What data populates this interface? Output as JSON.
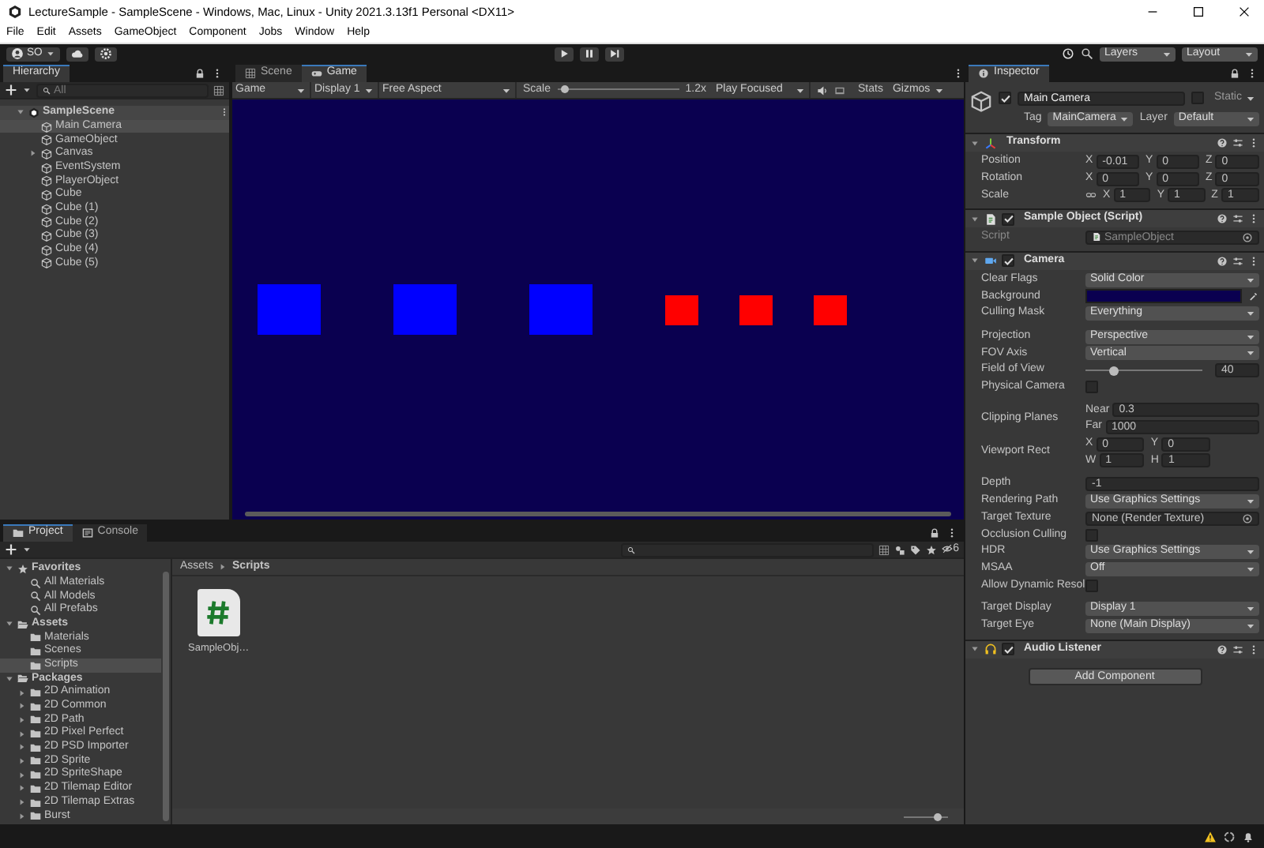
{
  "window": {
    "title": "LectureSample - SampleScene - Windows, Mac, Linux - Unity 2021.3.13f1 Personal <DX11>"
  },
  "menu": [
    "File",
    "Edit",
    "Assets",
    "GameObject",
    "Component",
    "Jobs",
    "Window",
    "Help"
  ],
  "toolbar": {
    "account": "SO",
    "layers": "Layers",
    "layout": "Layout"
  },
  "hierarchy": {
    "title": "Hierarchy",
    "search": {
      "placeholder": "All"
    },
    "scene": "SampleScene",
    "items": [
      {
        "label": "Main Camera",
        "selected": true,
        "has_children": false
      },
      {
        "label": "GameObject",
        "selected": false,
        "has_children": false
      },
      {
        "label": "Canvas",
        "selected": false,
        "has_children": true
      },
      {
        "label": "EventSystem",
        "selected": false,
        "has_children": false
      },
      {
        "label": "PlayerObject",
        "selected": false,
        "has_children": false
      },
      {
        "label": "Cube",
        "selected": false,
        "has_children": false
      },
      {
        "label": "Cube (1)",
        "selected": false,
        "has_children": false
      },
      {
        "label": "Cube (2)",
        "selected": false,
        "has_children": false
      },
      {
        "label": "Cube (3)",
        "selected": false,
        "has_children": false
      },
      {
        "label": "Cube (4)",
        "selected": false,
        "has_children": false
      },
      {
        "label": "Cube (5)",
        "selected": false,
        "has_children": false
      }
    ]
  },
  "game": {
    "tabs": [
      {
        "label": "Scene",
        "kind": "scene",
        "selected": false
      },
      {
        "label": "Game",
        "kind": "game",
        "selected": true
      }
    ],
    "view": "Game",
    "display": "Display 1",
    "aspect": "Free Aspect",
    "scale_label": "Scale",
    "scale": {
      "level": 0.06
    },
    "scale_value": "1.2x",
    "play_mode": "Play Focused",
    "stats": "Stats",
    "gizmos": "Gizmos",
    "objects": [
      {
        "kind": "large",
        "color": "#0000ff"
      },
      {
        "kind": "large",
        "color": "#0000ff"
      },
      {
        "kind": "large",
        "color": "#0000ff"
      },
      {
        "kind": "small",
        "color": "#ff0000"
      },
      {
        "kind": "small",
        "color": "#ff0000"
      },
      {
        "kind": "small",
        "color": "#ff0000"
      }
    ]
  },
  "inspector": {
    "title": "Inspector",
    "object": {
      "active": true,
      "name": "Main Camera",
      "static_label": "Static",
      "static": false,
      "tag_label": "Tag",
      "tag": "MainCamera",
      "layer_label": "Layer",
      "layer": "Default"
    },
    "components": [
      {
        "kind": "transform",
        "title": "Transform",
        "expanded": true,
        "groups": [
          [
            {
              "label": "Position",
              "kind": "fields",
              "rows": [
                [
                  {
                    "axis": "X",
                    "value": "-0.01"
                  },
                  {
                    "axis": "Y",
                    "value": "0"
                  },
                  {
                    "axis": "Z",
                    "value": "0"
                  }
                ]
              ]
            },
            {
              "label": "Rotation",
              "kind": "fields",
              "rows": [
                [
                  {
                    "axis": "X",
                    "value": "0"
                  },
                  {
                    "axis": "Y",
                    "value": "0"
                  },
                  {
                    "axis": "Z",
                    "value": "0"
                  }
                ]
              ]
            },
            {
              "label": "Scale",
              "kind": "fields",
              "linked": true,
              "rows": [
                [
                  {
                    "axis": "X",
                    "value": "1"
                  },
                  {
                    "axis": "Y",
                    "value": "1"
                  },
                  {
                    "axis": "Z",
                    "value": "1"
                  }
                ]
              ]
            }
          ]
        ]
      },
      {
        "kind": "script",
        "title": "Sample Object (Script)",
        "expanded": true,
        "enabled": true,
        "groups": [
          [
            {
              "label": "Script",
              "kind": "readonly",
              "value": "SampleObject"
            }
          ]
        ]
      },
      {
        "kind": "camera",
        "title": "Camera",
        "expanded": true,
        "enabled": true,
        "groups": [
          [
            {
              "label": "Clear Flags",
              "kind": "dropdown",
              "value": "Solid Color"
            },
            {
              "label": "Background",
              "kind": "color",
              "color": "#0a0050"
            },
            {
              "label": "Culling Mask",
              "kind": "dropdown",
              "value": "Everything"
            }
          ],
          [
            {
              "label": "Projection",
              "kind": "dropdown",
              "value": "Perspective"
            },
            {
              "label": "FOV Axis",
              "kind": "dropdown",
              "value": "Vertical"
            },
            {
              "label": "Field of View",
              "kind": "slider",
              "level": 0.24,
              "value": "40"
            },
            {
              "label": "Physical Camera",
              "kind": "checkbox",
              "checked": false
            }
          ],
          [
            {
              "label": "Clipping Planes",
              "kind": "fields",
              "rows": [
                [
                  {
                    "axis": "Near",
                    "value": "0.3"
                  }
                ],
                [
                  {
                    "axis": "Far",
                    "value": "1000"
                  }
                ]
              ]
            },
            {
              "label": "Viewport Rect",
              "kind": "fields",
              "rows": [
                [
                  {
                    "axis": "X",
                    "value": "0"
                  },
                  {
                    "axis": "Y",
                    "value": "0"
                  }
                ],
                [
                  {
                    "axis": "W",
                    "value": "1"
                  },
                  {
                    "axis": "H",
                    "value": "1"
                  }
                ]
              ]
            }
          ],
          [
            {
              "label": "Depth",
              "kind": "field",
              "value": "-1"
            },
            {
              "label": "Rendering Path",
              "kind": "dropdown",
              "value": "Use Graphics Settings"
            },
            {
              "label": "Target Texture",
              "kind": "object",
              "value": "None (Render Texture)"
            },
            {
              "label": "Occlusion Culling",
              "kind": "checkbox",
              "checked": false
            },
            {
              "label": "HDR",
              "kind": "dropdown",
              "value": "Use Graphics Settings"
            },
            {
              "label": "MSAA",
              "kind": "dropdown",
              "value": "Off"
            },
            {
              "label": "Allow Dynamic Resol",
              "kind": "checkbox",
              "checked": false
            }
          ],
          [
            {
              "label": "Target Display",
              "kind": "dropdown",
              "value": "Display 1"
            },
            {
              "label": "Target Eye",
              "kind": "dropdown",
              "value": "None (Main Display)"
            }
          ]
        ]
      },
      {
        "kind": "audio",
        "title": "Audio Listener",
        "expanded": true,
        "enabled": true
      }
    ],
    "add_button": "Add Component"
  },
  "project": {
    "tabs": [
      {
        "label": "Project",
        "kind": "project",
        "selected": true
      },
      {
        "label": "Console",
        "kind": "console",
        "selected": false
      }
    ],
    "hidden_count": "6",
    "tree": [
      {
        "label": "Favorites",
        "kind": "favorites",
        "expanded": true,
        "selected": false,
        "children": [
          {
            "label": "All Materials",
            "kind": "search",
            "selected": false
          },
          {
            "label": "All Models",
            "kind": "search",
            "selected": false
          },
          {
            "label": "All Prefabs",
            "kind": "search",
            "selected": false
          }
        ]
      },
      {
        "label": "Assets",
        "kind": "folder",
        "expanded": true,
        "selected": false,
        "children": [
          {
            "label": "Materials",
            "kind": "folder",
            "selected": false
          },
          {
            "label": "Scenes",
            "kind": "folder",
            "selected": false
          },
          {
            "label": "Scripts",
            "kind": "folder",
            "selected": true
          }
        ]
      },
      {
        "label": "Packages",
        "kind": "folder",
        "expanded": true,
        "selected": false,
        "children": [
          {
            "label": "2D Animation",
            "kind": "folder",
            "expanded": false,
            "selected": false
          },
          {
            "label": "2D Common",
            "kind": "folder",
            "expanded": false,
            "selected": false
          },
          {
            "label": "2D Path",
            "kind": "folder",
            "expanded": false,
            "selected": false
          },
          {
            "label": "2D Pixel Perfect",
            "kind": "folder",
            "expanded": false,
            "selected": false
          },
          {
            "label": "2D PSD Importer",
            "kind": "folder",
            "expanded": false,
            "selected": false
          },
          {
            "label": "2D Sprite",
            "kind": "folder",
            "expanded": false,
            "selected": false
          },
          {
            "label": "2D SpriteShape",
            "kind": "folder",
            "expanded": false,
            "selected": false
          },
          {
            "label": "2D Tilemap Editor",
            "kind": "folder",
            "expanded": false,
            "selected": false
          },
          {
            "label": "2D Tilemap Extras",
            "kind": "folder",
            "expanded": false,
            "selected": false
          },
          {
            "label": "Burst",
            "kind": "folder",
            "expanded": false,
            "selected": false
          }
        ]
      }
    ],
    "breadcrumb": [
      "Assets",
      "Scripts"
    ],
    "files": [
      {
        "name": "SampleObj…",
        "kind": "script"
      }
    ],
    "zoom": {
      "level": 0.75
    }
  }
}
